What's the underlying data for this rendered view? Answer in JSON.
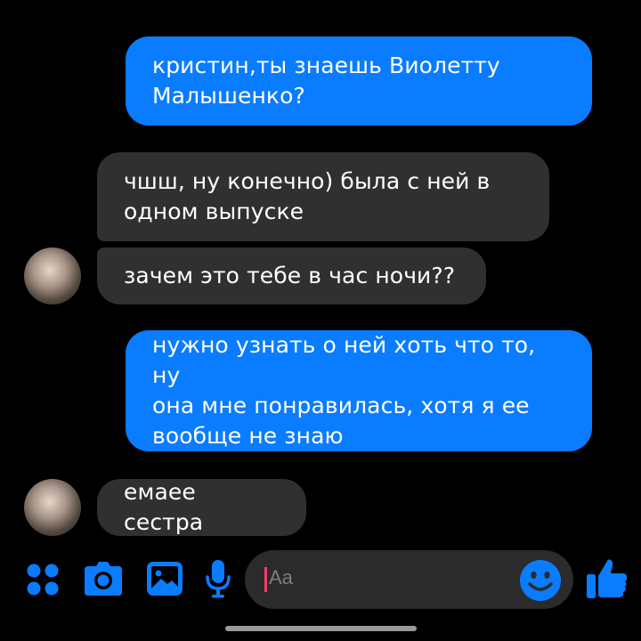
{
  "messages": [
    {
      "direction": "outgoing",
      "text": "кристин,ты знаешь Виолетту\nМалышенко?"
    },
    {
      "direction": "incoming",
      "text": "чшш, ну конечно) была с ней в\nодном выпуске"
    },
    {
      "direction": "incoming",
      "text": "зачем это тебе в час ночи??"
    },
    {
      "direction": "outgoing",
      "text": "нужно узнать о ней хоть что то, ну\nона мне понравилась, хотя я ее\nвообще не знаю"
    },
    {
      "direction": "incoming",
      "text": "емаее сестра"
    }
  ],
  "composer": {
    "placeholder": "Aa"
  },
  "toolbar_icons": [
    "apps-icon",
    "camera-icon",
    "gallery-icon",
    "mic-icon",
    "emoji-icon",
    "like-icon"
  ],
  "colors": {
    "outgoing_bubble": "#0a7cff",
    "incoming_bubble": "#303030",
    "background": "#000000",
    "accent": "#0a7cff"
  }
}
